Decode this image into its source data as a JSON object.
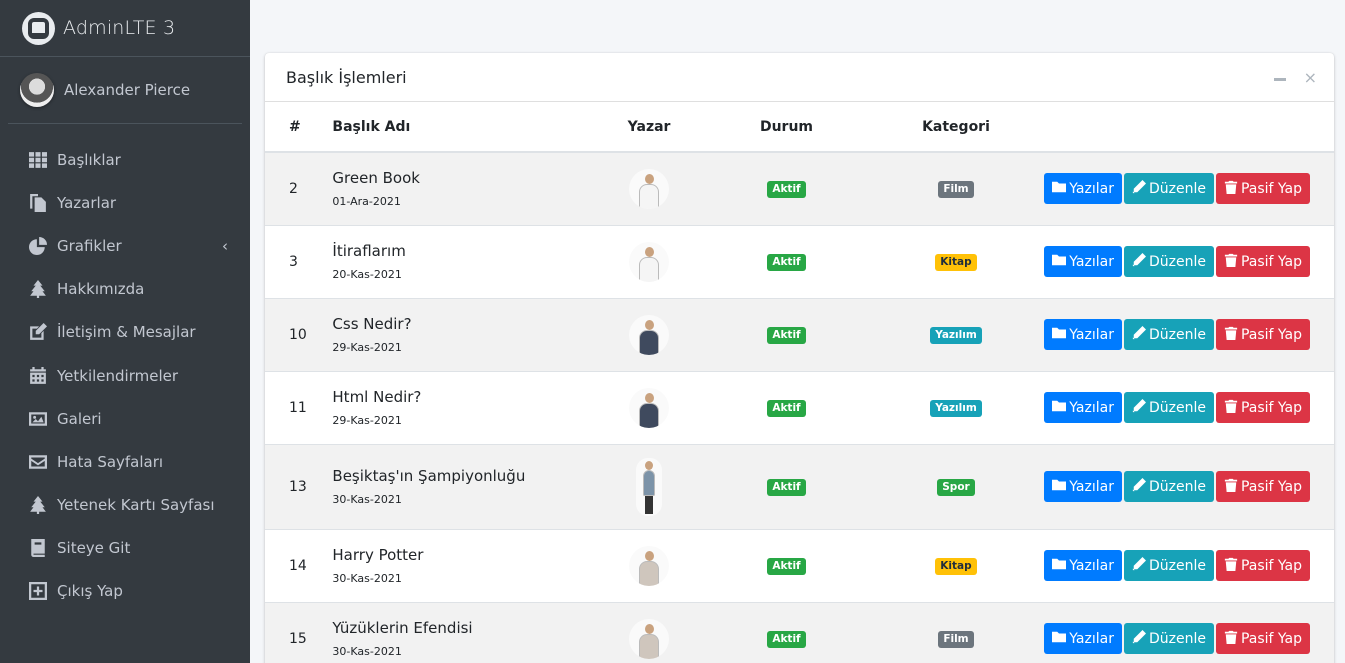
{
  "app": {
    "brand": "AdminLTE 3",
    "user_name": "Alexander Pierce"
  },
  "sidebar": {
    "items": [
      {
        "label": "Başlıklar",
        "icon": "grid-icon"
      },
      {
        "label": "Yazarlar",
        "icon": "copy-icon"
      },
      {
        "label": "Grafikler",
        "icon": "pie-chart-icon",
        "has_arrow": true
      },
      {
        "label": "Hakkımızda",
        "icon": "tree-icon"
      },
      {
        "label": "İletişim & Mesajlar",
        "icon": "edit-icon"
      },
      {
        "label": "Yetkilendirmeler",
        "icon": "calendar-icon"
      },
      {
        "label": "Galeri",
        "icon": "image-icon"
      },
      {
        "label": "Hata Sayfaları",
        "icon": "envelope-icon"
      },
      {
        "label": "Yetenek Kartı Sayfası",
        "icon": "tree-icon"
      },
      {
        "label": "Siteye Git",
        "icon": "book-icon"
      },
      {
        "label": "Çıkış Yap",
        "icon": "plus-square-icon"
      }
    ]
  },
  "card": {
    "title": "Başlık İşlemleri",
    "tools": {
      "collapse": "−",
      "close": "×"
    },
    "headers": [
      "#",
      "Başlık Adı",
      "Yazar",
      "Durum",
      "Kategori"
    ],
    "buttons": {
      "posts": "Yazılar",
      "edit": "Düzenle",
      "deactivate": "Pasif Yap"
    },
    "rows": [
      {
        "id": "2",
        "title": "Green Book",
        "date": "01-Ara-2021",
        "status": "Aktif",
        "category": "Film",
        "category_color": "#6c757d",
        "author_style": "man-light"
      },
      {
        "id": "3",
        "title": "İtiraflarım",
        "date": "20-Kas-2021",
        "status": "Aktif",
        "category": "Kitap",
        "category_color": "#ffc107",
        "author_style": "man-light"
      },
      {
        "id": "10",
        "title": "Css Nedir?",
        "date": "29-Kas-2021",
        "status": "Aktif",
        "category": "Yazılım",
        "category_color": "#17a2b8",
        "author_style": "man-suit"
      },
      {
        "id": "11",
        "title": "Html Nedir?",
        "date": "29-Kas-2021",
        "status": "Aktif",
        "category": "Yazılım",
        "category_color": "#17a2b8",
        "author_style": "man-suit"
      },
      {
        "id": "13",
        "title": "Beşiktaş'ın Şampiyonluğu",
        "date": "30-Kas-2021",
        "status": "Aktif",
        "category": "Spor",
        "category_color": "#28a745",
        "author_style": "man-standing"
      },
      {
        "id": "14",
        "title": "Harry Potter",
        "date": "30-Kas-2021",
        "status": "Aktif",
        "category": "Kitap",
        "category_color": "#ffc107",
        "author_style": "woman"
      },
      {
        "id": "15",
        "title": "Yüzüklerin Efendisi",
        "date": "30-Kas-2021",
        "status": "Aktif",
        "category": "Film",
        "category_color": "#6c757d",
        "author_style": "woman"
      }
    ]
  },
  "colors": {
    "sidebar": "#343a40",
    "primary": "#007bff",
    "info": "#17a2b8",
    "danger": "#dc3545",
    "success": "#28a745"
  }
}
